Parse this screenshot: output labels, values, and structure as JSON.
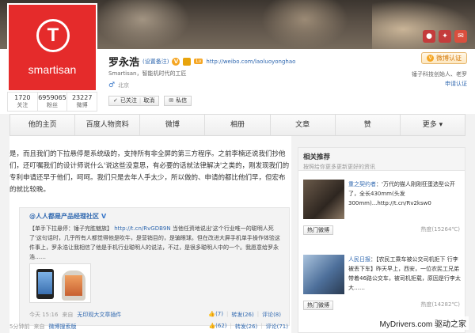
{
  "header": {
    "icons": [
      "mic-icon",
      "gift-icon",
      "mail-icon"
    ]
  },
  "profile": {
    "avatar_brand": "smartisan",
    "avatar_letter": "T",
    "name": "罗永浩",
    "remark": "(设置备注)",
    "level": "Lv",
    "url": "http://weibo.com/laoluoyonghao",
    "bio": "Smartisan，智能机时代的工匠",
    "gender_symbol": "♂",
    "location": "北京",
    "follow_state": "已关注",
    "cancel_label": "取消",
    "message_label": "私信",
    "stats": [
      {
        "num": "1720",
        "label": "关注"
      },
      {
        "num": "6959065",
        "label": "粉丝"
      },
      {
        "num": "23227",
        "label": "微博"
      }
    ],
    "verify_label": "微博认证",
    "verify_desc": "锤子科技创始人、老罗",
    "verify_link": "申请认证"
  },
  "nav": {
    "items": [
      "他的主页",
      "百度人物资料",
      "微博",
      "相册",
      "文章",
      "赞",
      "更多 ▾"
    ]
  },
  "post": {
    "text": "是，而且我们的下拉悬停是系统级的，支持所有非全屏的第三方程序。之前李楠还说我们抄他们，还叮嘱我们的设计师说什么'说这些没意思，有必要的话就法律解决'之类的，刚发现我们的专利申请还早于他们，呵呵。我们只是去年人手太少，所以做的、申请的都比他们早，但宏布的就比较晚。",
    "repost": {
      "author": "@人人都是产品经理社区",
      "verified": "V",
      "text_lead": "【单手下拉悬停：锤子完胜魅族】",
      "text_link": "http://t.cn/RvGDB9N",
      "text_body": " 当他任资地说出'这个行业唯一的聪明人死了'这句话时，几乎所有人都觉得他是吹牛，是营销目的，是骗眼球。但在改进大屏手机单手操作体验这件事上，罗永浩让我相信了他是手机行业聪明人的说法，不过，是很多聪明人中的一个。我愿意给罗永浩……",
      "time": "今天 15:16",
      "source_prefix": "来自",
      "source": "无印观大文章插件",
      "likes": "(7)",
      "forward": "转发(26)",
      "comment": "评论(8)"
    },
    "time": "5分钟前",
    "source_prefix": "来自",
    "source": "微博搜索版",
    "likes": "(62)",
    "forward": "转发(26)",
    "comment": "评论(71)"
  },
  "sidebar": {
    "title": "相关推荐",
    "subtitle": "按照给你更多更新更好的资讯",
    "items": [
      {
        "user": "重之契约者",
        "text": "：'万代的猫人刚刚狂蛋选型公开了，全长430mm(头发300mm)...http://t.cn/Rv2ksw0",
        "tag": "热门微博",
        "heat": "热度(15264℃)"
      },
      {
        "user": "人民日报",
        "text": "：【农民工乘车被公交司机拒下 行李被丢下车】昨天早上，西安，一位农民工兄弟带着46路公交车，被司机拒载，原因是行李太大……",
        "tag": "热门微博",
        "heat": "热度(14282℃)"
      }
    ]
  },
  "watermark": "MyDrivers.com 驱动之家"
}
